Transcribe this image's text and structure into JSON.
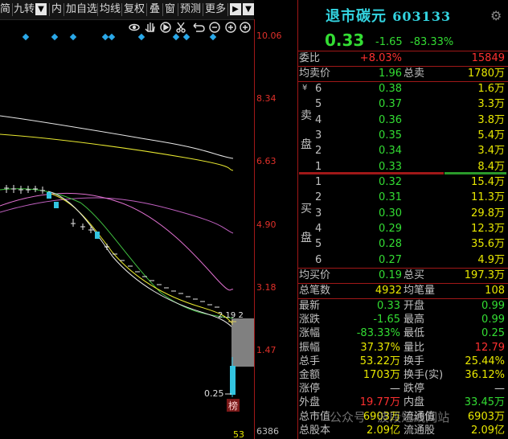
{
  "toolbar": {
    "items": [
      "简",
      "九转",
      "内",
      "加自选",
      "均线",
      "复权",
      "叠",
      "窗",
      "预测",
      "更多"
    ],
    "prev_label": "▶",
    "dropdown_label": "▼"
  },
  "chart": {
    "y_labels": [
      "10.06",
      "8.34",
      "6.63",
      "4.90",
      "3.18",
      "1.47"
    ],
    "volume_label": "6386",
    "low_price_label": "0.25",
    "ma_labels": "2.19 2",
    "badge": "榜",
    "bottom_number": "53"
  },
  "stock": {
    "name": "退市碳元",
    "code": "603133",
    "price": "0.33",
    "change": "-1.65",
    "change_pct": "-83.33%"
  },
  "commission": {
    "label": "委比",
    "ratio": "+8.03%",
    "diff": "15849"
  },
  "avg_sell": {
    "label": "均卖价",
    "price": "1.96",
    "total_label": "总卖",
    "total": "1780万"
  },
  "sell": {
    "label_top": "卖",
    "label_bottom": "盘",
    "yen": "¥",
    "rows": [
      {
        "level": "6",
        "price": "0.38",
        "vol": "1.6万"
      },
      {
        "level": "5",
        "price": "0.37",
        "vol": "3.3万"
      },
      {
        "level": "4",
        "price": "0.36",
        "vol": "3.8万"
      },
      {
        "level": "3",
        "price": "0.35",
        "vol": "5.4万"
      },
      {
        "level": "2",
        "price": "0.34",
        "vol": "3.4万"
      },
      {
        "level": "1",
        "price": "0.33",
        "vol": "8.4万"
      }
    ]
  },
  "buy": {
    "label_top": "买",
    "label_bottom": "盘",
    "rows": [
      {
        "level": "1",
        "price": "0.32",
        "vol": "15.4万"
      },
      {
        "level": "2",
        "price": "0.31",
        "vol": "11.3万"
      },
      {
        "level": "3",
        "price": "0.30",
        "vol": "29.8万"
      },
      {
        "level": "4",
        "price": "0.29",
        "vol": "12.3万"
      },
      {
        "level": "5",
        "price": "0.28",
        "vol": "35.6万"
      },
      {
        "level": "6",
        "price": "0.27",
        "vol": "4.9万"
      }
    ]
  },
  "avg_buy": {
    "label": "均买价",
    "price": "0.19",
    "total_label": "总买",
    "total": "197.3万"
  },
  "trades": {
    "label": "总笔数",
    "value": "4932",
    "avg_label": "均笔量",
    "avg": "108"
  },
  "stats": [
    {
      "l1": "最新",
      "v1": "0.33",
      "c1": "green",
      "l2": "开盘",
      "v2": "0.99",
      "c2": "green"
    },
    {
      "l1": "涨跌",
      "v1": "-1.65",
      "c1": "green",
      "l2": "最高",
      "v2": "0.99",
      "c2": "green"
    },
    {
      "l1": "涨幅",
      "v1": "-83.33%",
      "c1": "green",
      "l2": "最低",
      "v2": "0.25",
      "c2": "green"
    },
    {
      "l1": "振幅",
      "v1": "37.37%",
      "c1": "yellow",
      "l2": "量比",
      "v2": "12.79",
      "c2": "red"
    },
    {
      "l1": "总手",
      "v1": "53.22万",
      "c1": "yellow",
      "l2": "换手",
      "v2": "25.44%",
      "c2": "yellow"
    },
    {
      "l1": "金额",
      "v1": "1703万",
      "c1": "yellow",
      "l2": "换手(实)",
      "v2": "36.12%",
      "c2": "yellow"
    },
    {
      "l1": "涨停",
      "v1": "—",
      "c1": "white",
      "l2": "跌停",
      "v2": "—",
      "c2": "white"
    },
    {
      "l1": "外盘",
      "v1": "19.77万",
      "c1": "red",
      "l2": "内盘",
      "v2": "33.45万",
      "c2": "green"
    },
    {
      "l1": "总市值",
      "v1": "6903万",
      "c1": "yellow",
      "l2": "流通值",
      "v2": "6903万",
      "c2": "yellow"
    },
    {
      "l1": "总股本",
      "v1": "2.09亿",
      "c1": "yellow",
      "l2": "流通股",
      "v2": "2.09亿",
      "c2": "yellow"
    }
  ],
  "watermark": "公众号 · 波段短线网站",
  "colors": {
    "cyan": "#33d4e0",
    "green": "#33dd33",
    "red": "#ff3030",
    "yellow": "#e8e800"
  }
}
